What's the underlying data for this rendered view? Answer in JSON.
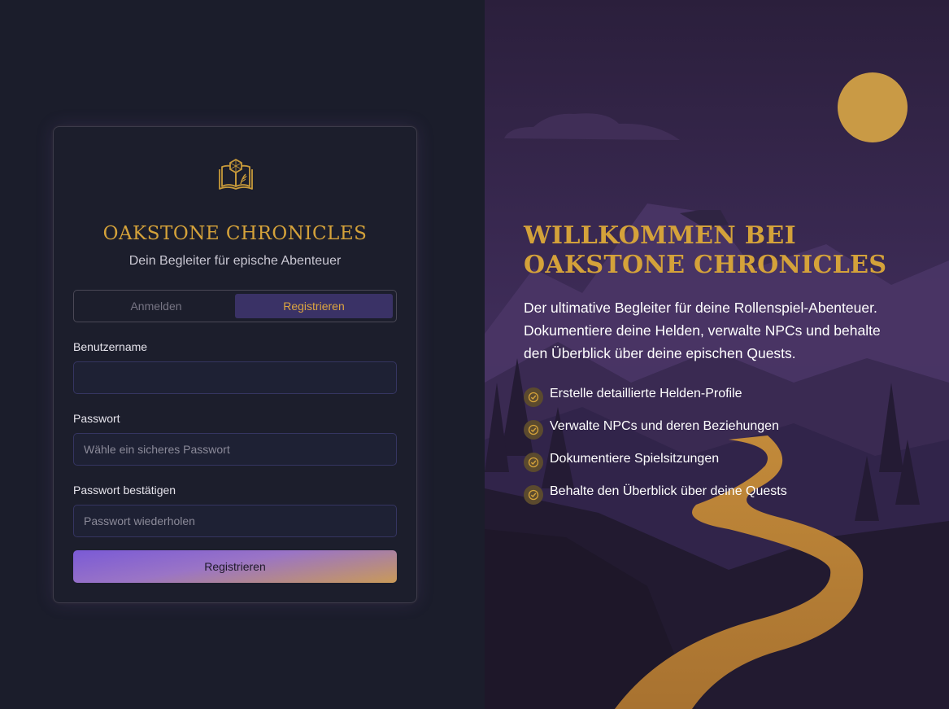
{
  "app": {
    "title": "Oakstone Chronicles",
    "subtitle": "Dein Begleiter für epische Abenteuer"
  },
  "tabs": [
    {
      "label": "Anmelden",
      "active": false
    },
    {
      "label": "Registrieren",
      "active": true
    }
  ],
  "form": {
    "username": {
      "label": "Benutzername",
      "value": "",
      "placeholder": ""
    },
    "password": {
      "label": "Passwort",
      "value": "",
      "placeholder": "Wähle ein sicheres Passwort"
    },
    "confirm": {
      "label": "Passwort bestätigen",
      "value": "",
      "placeholder": "Passwort wiederholen"
    },
    "submit_label": "Registrieren"
  },
  "hero": {
    "heading": "Willkommen bei Oakstone Chronicles",
    "intro": "Der ultimative Begleiter für deine Rollenspiel-Abenteuer. Dokumentiere deine Helden, verwalte NPCs und behalte den Überblick über deine epischen Quests.",
    "features": [
      "Erstelle detaillierte Helden-Profile",
      "Verwalte NPCs und deren Beziehungen",
      "Dokumentiere Spielsitzungen",
      "Behalte den Überblick über deine Quests"
    ]
  },
  "icons": {
    "logo": "book-d20-icon",
    "feature_check": "check-circle-icon"
  },
  "colors": {
    "accent_gold": "#d4a23a",
    "accent_purple": "#3a3266",
    "background": "#1b1d2b"
  }
}
